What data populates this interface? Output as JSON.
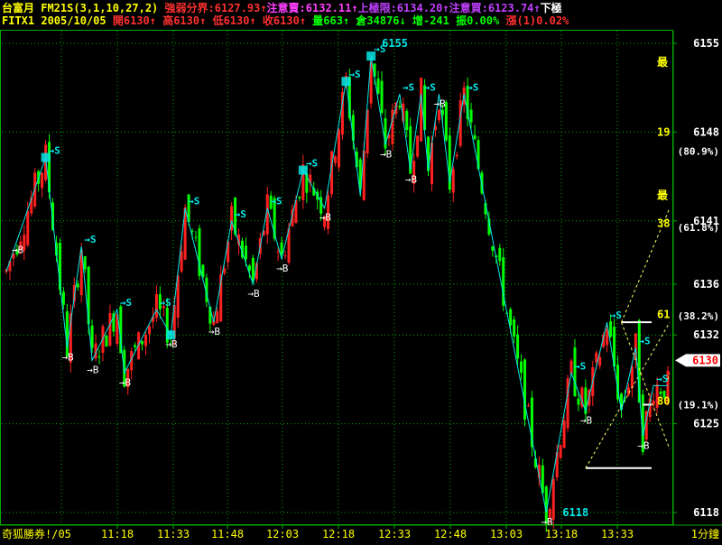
{
  "header": {
    "row1_left": "台富月",
    "indicator": "FM21S(3,1,10,27,2)",
    "items": [
      {
        "label": "強弱分界:",
        "value": "6127.93",
        "arrow": "↑",
        "color": "#ff3030"
      },
      {
        "label": "注意賣:",
        "value": "6132.11",
        "arrow": "↑",
        "color": "#ff40ff"
      },
      {
        "label": "上極限:",
        "value": "6134.20",
        "arrow": "↑",
        "color": "#c040ff"
      },
      {
        "label": "注意買:",
        "value": "6123.74",
        "arrow": "↑",
        "color": "#c040ff"
      },
      {
        "label": "下極",
        "value": "",
        "arrow": "",
        "color": "#ffffff"
      }
    ],
    "row2_left": "FITX1",
    "date": "2005/10/05",
    "quote": [
      {
        "text": "開6130↑",
        "color": "#ff3030"
      },
      {
        "text": "高6130↑",
        "color": "#ff3030"
      },
      {
        "text": "低6130↑",
        "color": "#ff3030"
      },
      {
        "text": "收6130↑",
        "color": "#ff3030"
      },
      {
        "text": "量663↑",
        "color": "#00ff00"
      },
      {
        "text": "倉34876↓",
        "color": "#00ff00"
      },
      {
        "text": "增-241",
        "color": "#00ff00"
      },
      {
        "text": "振0.00%",
        "color": "#00ff00"
      },
      {
        "text": "漲(1)0.02%",
        "color": "#ff3030"
      }
    ]
  },
  "footer": {
    "left_label": "奇狐勝券!/05",
    "right_label": "1分鐘"
  },
  "colors": {
    "up": "#ff2020",
    "down": "#00ff00",
    "zigzag": "#00e8e8",
    "grid": "#00aa00",
    "price_axis": "#ffffff",
    "fib": "#ffff00",
    "current_tag_bg": "#ffffff",
    "current_tag_fg": "#ff0000"
  },
  "chart_data": {
    "type": "candlestick",
    "symbol": "FITX1",
    "interval": "1分鐘",
    "x_ticks": [
      "11:18",
      "11:33",
      "11:48",
      "12:03",
      "12:18",
      "12:33",
      "12:48",
      "13:03",
      "13:18",
      "13:33"
    ],
    "y_ticks": [
      6155,
      6148,
      6141,
      6136,
      6132,
      6125,
      6118
    ],
    "ylim": [
      6117,
      6156
    ],
    "current_price": 6130,
    "high_label": "6155",
    "low_label": "6118",
    "fib_levels": [
      {
        "label": "(80.9%)",
        "price": 6146.5
      },
      {
        "label": "(61.8%)",
        "price": 6140.5
      },
      {
        "label": "(38.2%)",
        "price": 6133.5
      },
      {
        "label": "(19.1%)",
        "price": 6126.5
      }
    ],
    "right_marks": [
      "最",
      "19",
      "最",
      "38",
      "61",
      "80"
    ],
    "zigzag": [
      [
        0,
        6137
      ],
      [
        11,
        6146
      ],
      [
        17,
        6131
      ],
      [
        21,
        6139
      ],
      [
        24,
        6130
      ],
      [
        31,
        6134
      ],
      [
        33,
        6129
      ],
      [
        42,
        6134
      ],
      [
        46,
        6132
      ],
      [
        50,
        6142
      ],
      [
        58,
        6133
      ],
      [
        63,
        6141
      ],
      [
        69,
        6136
      ],
      [
        73,
        6142
      ],
      [
        77,
        6138
      ],
      [
        83,
        6145
      ],
      [
        89,
        6142
      ],
      [
        95,
        6152
      ],
      [
        99,
        6143
      ],
      [
        102,
        6154
      ],
      [
        106,
        6147
      ],
      [
        110,
        6151
      ],
      [
        113,
        6145
      ],
      [
        116,
        6151
      ],
      [
        118,
        6145
      ],
      [
        121,
        6151
      ],
      [
        124,
        6144
      ],
      [
        128,
        6151
      ],
      [
        151,
        6118
      ],
      [
        158,
        6129
      ],
      [
        162,
        6126
      ],
      [
        168,
        6133
      ],
      [
        172,
        6126
      ],
      [
        176,
        6131
      ],
      [
        178,
        6124
      ],
      [
        181,
        6128
      ],
      [
        185,
        6128
      ]
    ],
    "buy_markers": [
      {
        "x": 3,
        "label": "→B"
      },
      {
        "x": 17,
        "label": "→B"
      },
      {
        "x": 24,
        "label": "→B"
      },
      {
        "x": 33,
        "label": "→B"
      },
      {
        "x": 46,
        "label": "→B"
      },
      {
        "x": 58,
        "label": "→B"
      },
      {
        "x": 69,
        "label": "→B"
      },
      {
        "x": 77,
        "label": "→B"
      },
      {
        "x": 89,
        "label": "→B"
      },
      {
        "x": 106,
        "label": "→B"
      },
      {
        "x": 113,
        "label": "→B"
      },
      {
        "x": 121,
        "label": "→B"
      },
      {
        "x": 151,
        "label": "→B"
      },
      {
        "x": 162,
        "label": "→B"
      },
      {
        "x": 178,
        "label": "→B"
      }
    ],
    "sell_markers": [
      {
        "x": 11,
        "label": "→S"
      },
      {
        "x": 21,
        "label": "→S"
      },
      {
        "x": 31,
        "label": "→S"
      },
      {
        "x": 42,
        "label": "→S"
      },
      {
        "x": 50,
        "label": "→S"
      },
      {
        "x": 63,
        "label": "→S"
      },
      {
        "x": 73,
        "label": "→S"
      },
      {
        "x": 83,
        "label": "→S"
      },
      {
        "x": 95,
        "label": "→S"
      },
      {
        "x": 102,
        "label": "→S"
      },
      {
        "x": 110,
        "label": "→S"
      },
      {
        "x": 116,
        "label": "→S"
      },
      {
        "x": 128,
        "label": "→S"
      },
      {
        "x": 158,
        "label": "→S"
      },
      {
        "x": 168,
        "label": "→S"
      },
      {
        "x": 176,
        "label": "→S"
      },
      {
        "x": 181,
        "label": "→S"
      }
    ],
    "sell_box_markers": [
      {
        "x": 11
      },
      {
        "x": 46
      },
      {
        "x": 83
      },
      {
        "x": 95
      },
      {
        "x": 102
      }
    ]
  }
}
